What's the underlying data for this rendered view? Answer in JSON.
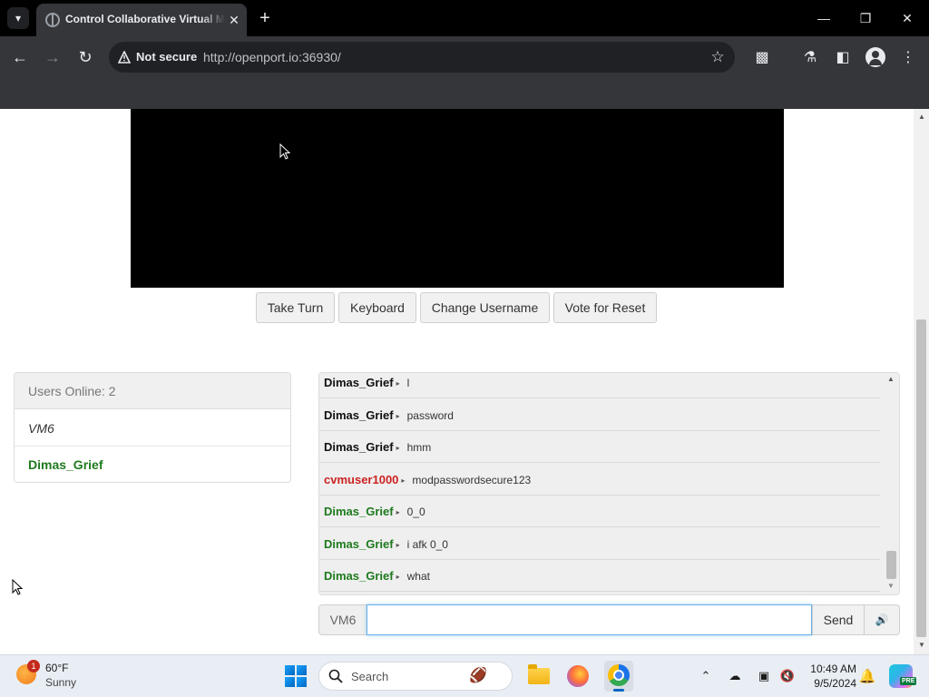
{
  "browser": {
    "tab_title": "Control Collaborative Virtual Machines",
    "security_label": "Not secure",
    "url": "http://openport.io:36930/"
  },
  "vm_controls": {
    "take_turn": "Take Turn",
    "keyboard": "Keyboard",
    "change_username": "Change Username",
    "vote_reset": "Vote for Reset"
  },
  "users": {
    "header": "Users Online: 2",
    "list": [
      {
        "name": "VM6"
      },
      {
        "name": "Dimas_Grief"
      }
    ]
  },
  "chat": {
    "messages": [
      {
        "user": "Dimas_Grief",
        "text": "l",
        "color": "#111111"
      },
      {
        "user": "Dimas_Grief",
        "text": "password",
        "color": "#111111"
      },
      {
        "user": "Dimas_Grief",
        "text": "hmm",
        "color": "#111111"
      },
      {
        "user": "cvmuser1000",
        "text": "modpasswordsecure123",
        "color": "#cc2222"
      },
      {
        "user": "Dimas_Grief",
        "text": "0_0",
        "color": "#1e7a1e"
      },
      {
        "user": "Dimas_Grief",
        "text": "i afk 0_0",
        "color": "#1e7a1e"
      },
      {
        "user": "Dimas_Grief",
        "text": "what",
        "color": "#1e7a1e"
      }
    ],
    "input_prefix": "VM6",
    "input_value": "",
    "send_label": "Send"
  },
  "taskbar": {
    "weather_badge": "1",
    "weather_temp": "60°F",
    "weather_desc": "Sunny",
    "search_label": "Search",
    "time": "10:49 AM",
    "date": "9/5/2024",
    "copilot_badge": "PRE"
  }
}
